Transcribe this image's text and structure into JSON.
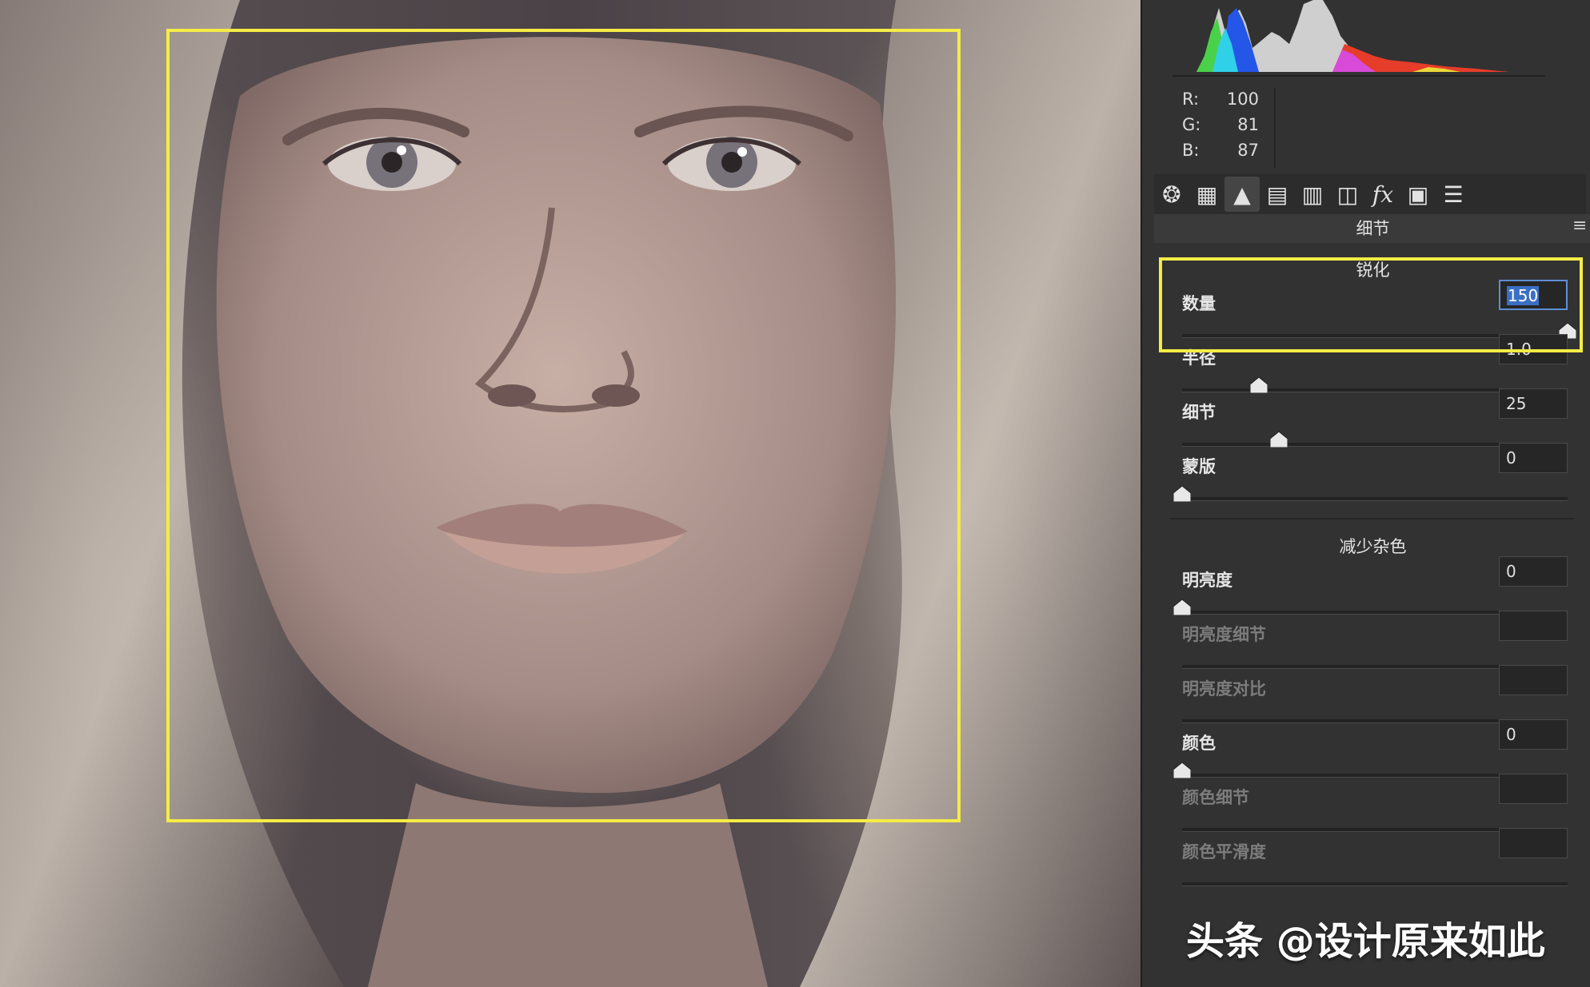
{
  "rgb_readout": [
    {
      "label": "R:",
      "value": "100"
    },
    {
      "label": "G:",
      "value": "81"
    },
    {
      "label": "B:",
      "value": "87"
    }
  ],
  "toolbar": [
    {
      "icon": "aperture-icon",
      "glyph": "❂",
      "active": false
    },
    {
      "icon": "tone-curve-icon",
      "glyph": "▦",
      "active": false
    },
    {
      "icon": "detail-icon",
      "glyph": "▲",
      "active": true
    },
    {
      "icon": "hsl-icon",
      "glyph": "▤",
      "active": false
    },
    {
      "icon": "split-toning-icon",
      "glyph": "▥",
      "active": false
    },
    {
      "icon": "lens-corrections-icon",
      "glyph": "◫",
      "active": false
    },
    {
      "icon": "effects-icon",
      "glyph": "fx",
      "active": false
    },
    {
      "icon": "camera-calibration-icon",
      "glyph": "▣",
      "active": false
    },
    {
      "icon": "presets-icon",
      "glyph": "☰",
      "active": false
    }
  ],
  "panel_title": "细节",
  "menu_glyph": "≡",
  "sharpening": {
    "heading": "锐化",
    "sliders": [
      {
        "label": "数量",
        "value": "150",
        "fraction": 1.0,
        "selected": true
      },
      {
        "label": "半径",
        "value": "1.0",
        "fraction": 0.2
      },
      {
        "label": "细节",
        "value": "25",
        "fraction": 0.25
      },
      {
        "label": "蒙版",
        "value": "0",
        "fraction": 0.0
      }
    ]
  },
  "noise_reduction": {
    "heading": "减少杂色",
    "sliders": [
      {
        "label": "明亮度",
        "value": "0",
        "fraction": 0.0,
        "disabled": false
      },
      {
        "label": "明亮度细节",
        "value": "",
        "fraction": null,
        "disabled": true
      },
      {
        "label": "明亮度对比",
        "value": "",
        "fraction": null,
        "disabled": true
      },
      {
        "label": "颜色",
        "value": "0",
        "fraction": 0.0,
        "disabled": false
      },
      {
        "label": "颜色细节",
        "value": "",
        "fraction": null,
        "disabled": true
      },
      {
        "label": "颜色平滑度",
        "value": "",
        "fraction": null,
        "disabled": true
      }
    ]
  },
  "watermark": "头条 @设计原来如此",
  "colors": {
    "highlight_box": "#f4ec45",
    "panel_bg": "#323232",
    "selection": "#3b6fc4"
  }
}
